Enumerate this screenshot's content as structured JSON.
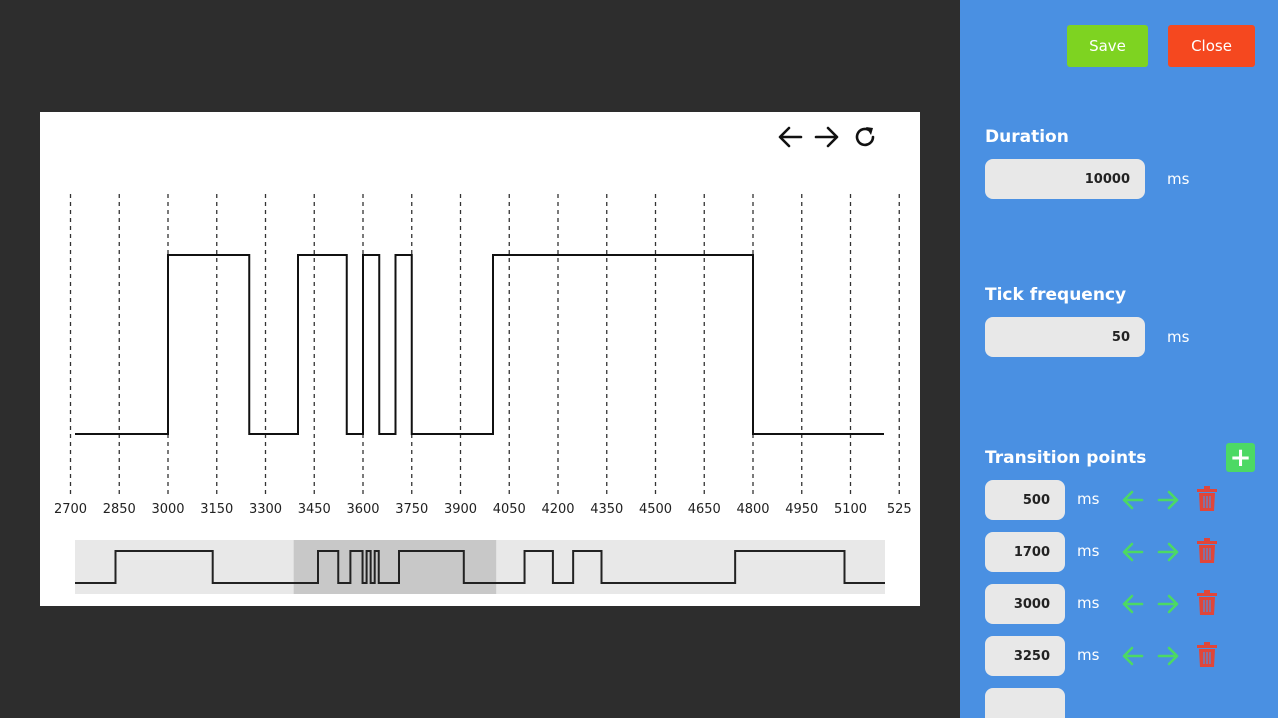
{
  "toolbar": {
    "save_label": "Save",
    "close_label": "Close"
  },
  "settings": {
    "duration_label": "Duration",
    "duration_value": "10000",
    "duration_unit": "ms",
    "tick_label": "Tick frequency",
    "tick_value": "50",
    "tick_unit": "ms",
    "transitions_label": "Transition points",
    "add_label": "+"
  },
  "transitions": [
    {
      "value": "500",
      "unit": "ms"
    },
    {
      "value": "1700",
      "unit": "ms"
    },
    {
      "value": "3000",
      "unit": "ms"
    },
    {
      "value": "3250",
      "unit": "ms"
    }
  ],
  "colors": {
    "panel": "#4a90e2",
    "save": "#7ed321",
    "close": "#f5481f",
    "add": "#4cd964",
    "arrow": "#4cd964",
    "trash": "#e0463a"
  },
  "chart_data": {
    "type": "line",
    "step": true,
    "x_ticks": [
      "2700",
      "2850",
      "3000",
      "3150",
      "3300",
      "3450",
      "3600",
      "3750",
      "3900",
      "4050",
      "4200",
      "4350",
      "4500",
      "4650",
      "4800",
      "4950",
      "5100",
      "525"
    ],
    "xlim": [
      2700,
      5220
    ],
    "signal": {
      "x": [
        2700,
        3000,
        3250,
        3400,
        3550,
        3600,
        3650,
        3700,
        3750,
        4000,
        4800,
        5220
      ],
      "y": [
        0,
        1,
        0,
        1,
        0,
        1,
        0,
        1,
        0,
        1,
        0,
        0
      ]
    },
    "overview": {
      "xlim": [
        0,
        10000
      ],
      "window": [
        2700,
        5200
      ],
      "x": [
        0,
        500,
        1700,
        3000,
        3250,
        3400,
        3550,
        3600,
        3650,
        3700,
        3750,
        4000,
        4800,
        5550,
        5900,
        6150,
        6500,
        8150,
        9500,
        10000
      ],
      "y": [
        0,
        1,
        0,
        1,
        0,
        1,
        0,
        1,
        0,
        1,
        0,
        1,
        0,
        1,
        0,
        1,
        0,
        1,
        0,
        0
      ]
    }
  }
}
